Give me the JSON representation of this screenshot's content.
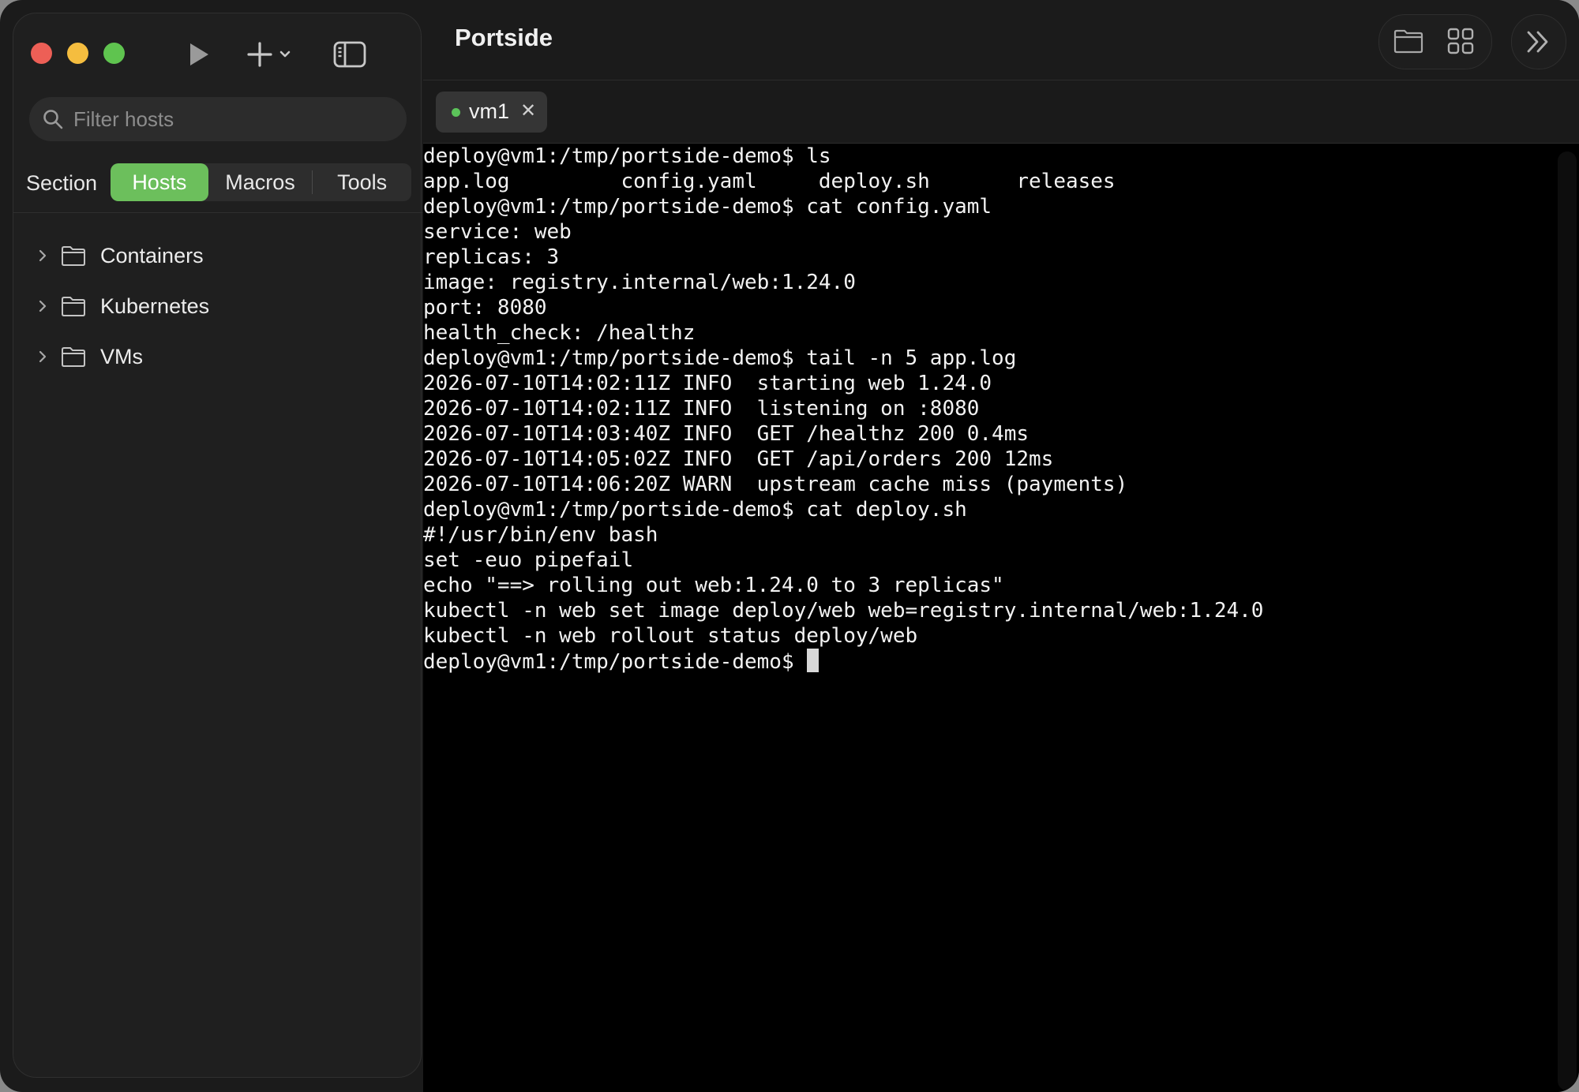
{
  "window": {
    "title": "Portside",
    "controls": [
      "close",
      "minimize",
      "zoom"
    ]
  },
  "toolbar": {
    "icons": [
      "play-icon",
      "plus-icon",
      "chevron-down-icon",
      "sidebar-toggle-icon"
    ]
  },
  "sidebar": {
    "search": {
      "placeholder": "Filter hosts",
      "value": ""
    },
    "section_label": "Section",
    "segments": [
      {
        "label": "Hosts",
        "active": true
      },
      {
        "label": "Macros",
        "active": false
      },
      {
        "label": "Tools",
        "active": false
      }
    ],
    "tree": [
      {
        "label": "Containers",
        "expanded": false
      },
      {
        "label": "Kubernetes",
        "expanded": false
      },
      {
        "label": "VMs",
        "expanded": false
      }
    ]
  },
  "header": {
    "icons": [
      "folder-icon",
      "grid-icon",
      "double-chevron-right-icon"
    ]
  },
  "tabs": [
    {
      "label": "vm1",
      "status_color": "#5cc45a",
      "close_glyph": "✕",
      "active": true
    }
  ],
  "terminal": {
    "prompt": "deploy@vm1:/tmp/portside-demo$",
    "lines": [
      "deploy@vm1:/tmp/portside-demo$ ls",
      "app.log         config.yaml     deploy.sh       releases",
      "deploy@vm1:/tmp/portside-demo$ cat config.yaml",
      "service: web",
      "replicas: 3",
      "image: registry.internal/web:1.24.0",
      "port: 8080",
      "health_check: /healthz",
      "deploy@vm1:/tmp/portside-demo$ tail -n 5 app.log",
      "2026-07-10T14:02:11Z INFO  starting web 1.24.0",
      "2026-07-10T14:02:11Z INFO  listening on :8080",
      "2026-07-10T14:03:40Z INFO  GET /healthz 200 0.4ms",
      "2026-07-10T14:05:02Z INFO  GET /api/orders 200 12ms",
      "2026-07-10T14:06:20Z WARN  upstream cache miss (payments)",
      "deploy@vm1:/tmp/portside-demo$ cat deploy.sh",
      "#!/usr/bin/env bash",
      "set -euo pipefail",
      "echo \"==> rolling out web:1.24.0 to 3 replicas\"",
      "kubectl -n web set image deploy/web web=registry.internal/web:1.24.0",
      "kubectl -n web rollout status deploy/web"
    ]
  },
  "colors": {
    "accent": "#6cbf5c",
    "close": "#ed5f56",
    "minimize": "#f5bd3f",
    "zoom": "#5fc44f",
    "terminal_bg": "#000000"
  }
}
